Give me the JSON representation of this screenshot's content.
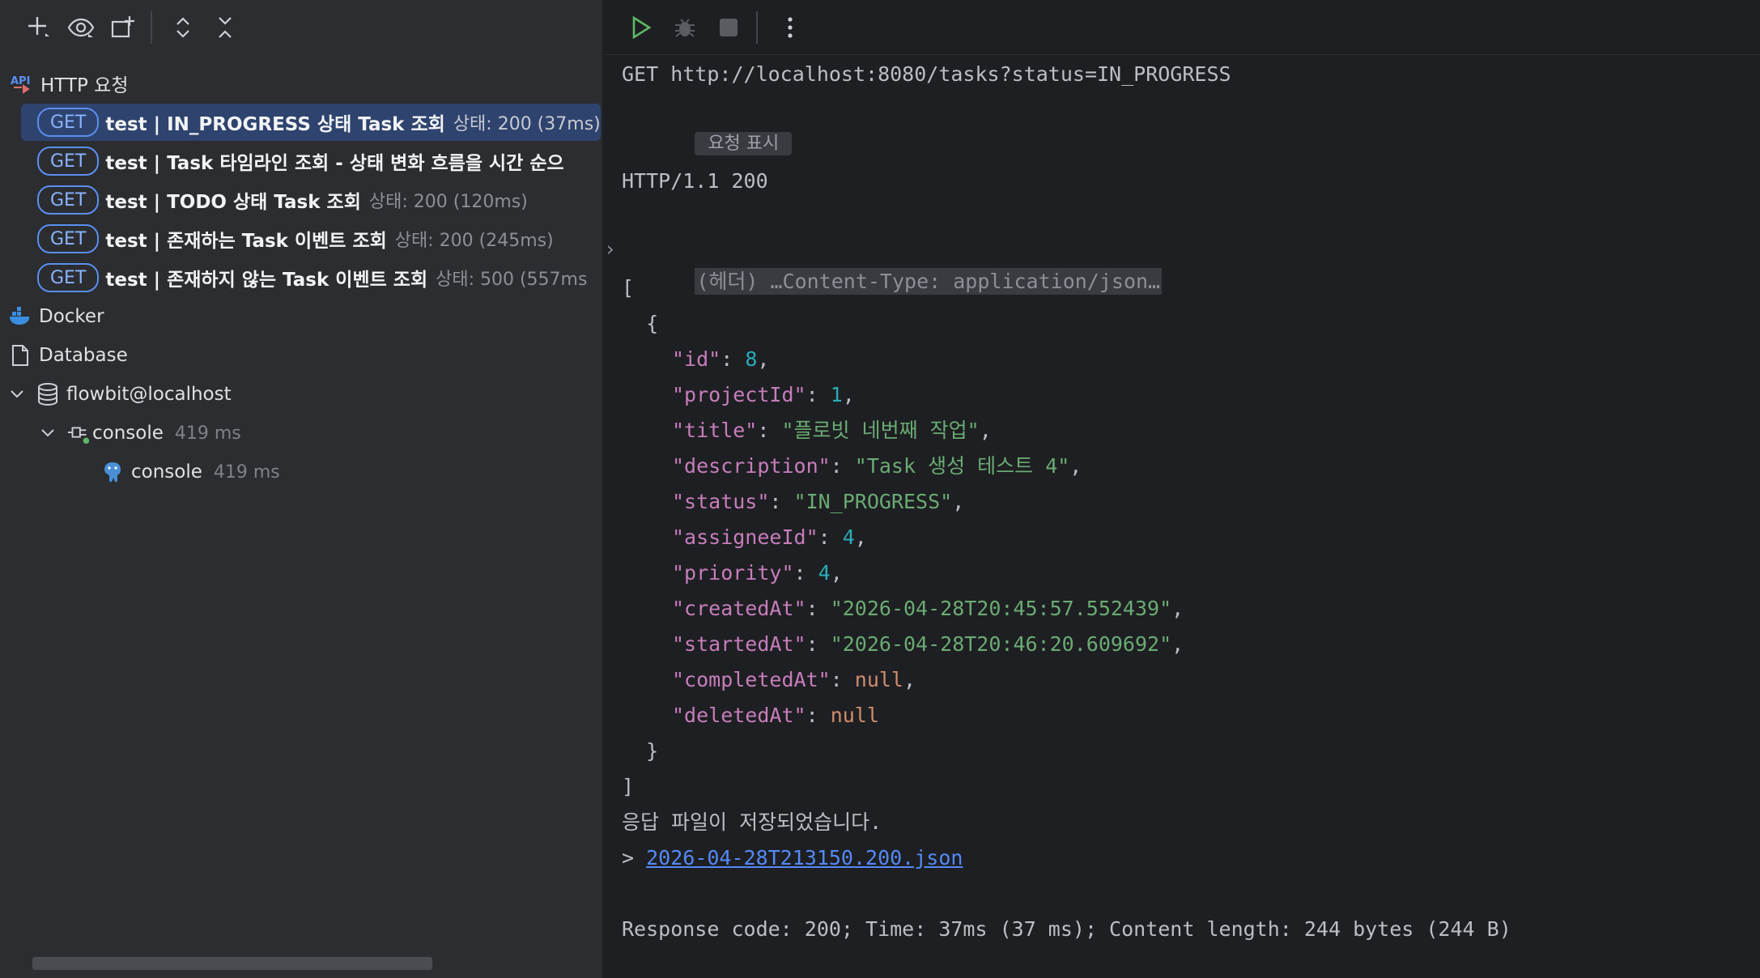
{
  "left_toolbar": {
    "icons": [
      "add-icon",
      "eye-icon",
      "new-tab-icon",
      "expand-all-icon",
      "collapse-all-icon"
    ]
  },
  "tree": {
    "http_section": {
      "label": "HTTP 요청"
    },
    "requests": [
      {
        "method": "GET",
        "name": "test  |  IN_PROGRESS 상태 Task 조회",
        "status": "상태: 200 (37ms)"
      },
      {
        "method": "GET",
        "name": "test  |  Task 타임라인 조회 - 상태 변화 흐름을 시간 순으",
        "status": ""
      },
      {
        "method": "GET",
        "name": "test  |  TODO 상태 Task 조회",
        "status": "상태: 200 (120ms)"
      },
      {
        "method": "GET",
        "name": "test  |  존재하는 Task 이벤트 조회",
        "status": "상태: 200 (245ms)"
      },
      {
        "method": "GET",
        "name": "test  |  존재하지 않는 Task 이벤트 조회",
        "status": "상태: 500 (557ms"
      }
    ],
    "docker": {
      "label": "Docker"
    },
    "database": {
      "label": "Database"
    },
    "datasource": {
      "label": "flowbit@localhost"
    },
    "console_session": {
      "label": "console",
      "time": "419 ms"
    },
    "console_child": {
      "label": "console",
      "time": "419 ms"
    }
  },
  "right": {
    "request_line": "GET http://localhost:8080/tasks?status=IN_PROGRESS",
    "show_request_label": "요청 표시",
    "http_status": "HTTP/1.1 200",
    "headers_collapsed": "(헤더) …Content-Type: application/json…",
    "json_lines": {
      "open_bracket": "[",
      "open_brace": "  {",
      "id_key": "\"id\"",
      "id_val": "8",
      "projectId_key": "\"projectId\"",
      "projectId_val": "1",
      "title_key": "\"title\"",
      "title_val": "\"플로빗 네번째 작업\"",
      "description_key": "\"description\"",
      "description_val": "\"Task 생성 테스트 4\"",
      "status_key": "\"status\"",
      "status_val": "\"IN_PROGRESS\"",
      "assigneeId_key": "\"assigneeId\"",
      "assigneeId_val": "4",
      "priority_key": "\"priority\"",
      "priority_val": "4",
      "createdAt_key": "\"createdAt\"",
      "createdAt_val": "\"2026-04-28T20:45:57.552439\"",
      "startedAt_key": "\"startedAt\"",
      "startedAt_val": "\"2026-04-28T20:46:20.609692\"",
      "completedAt_key": "\"completedAt\"",
      "completedAt_val": "null",
      "deletedAt_key": "\"deletedAt\"",
      "deletedAt_val": "null",
      "close_brace": "  }",
      "close_bracket": "]"
    },
    "saved_message": "응답 파일이 저장되었습니다.",
    "saved_prefix": "> ",
    "saved_file": "2026-04-28T213150.200.json",
    "summary": "Response code: 200; Time: 37ms (37 ms); Content length: 244 bytes (244 B)"
  }
}
